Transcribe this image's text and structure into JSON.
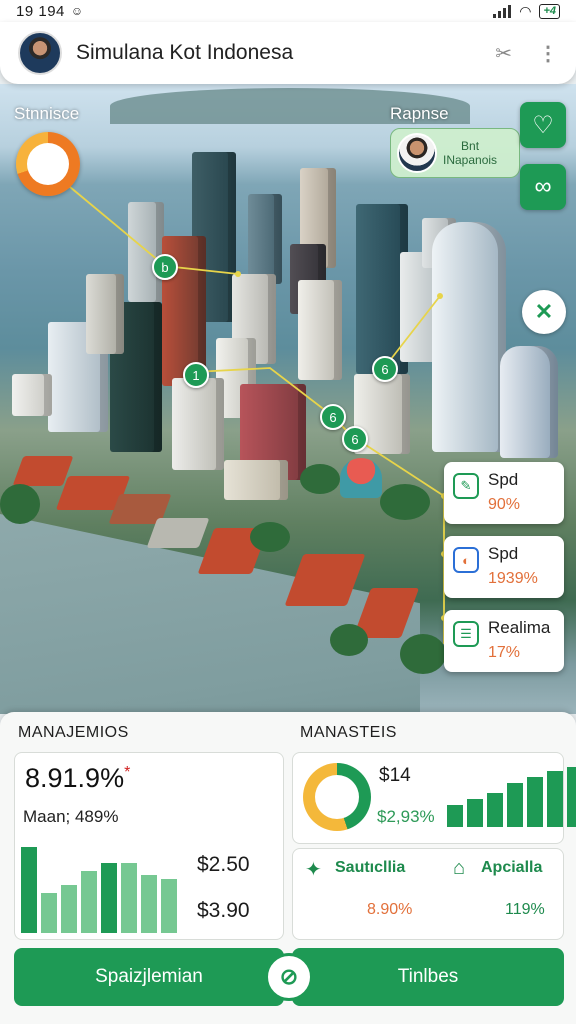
{
  "status_bar": {
    "time": "19 194",
    "battery": "+4"
  },
  "app_bar": {
    "title": "Simulana Kot Indonesa",
    "tool_icon": "tools-icon",
    "more_icon": "more-vert-icon"
  },
  "map": {
    "label_left": "Stnnisce",
    "label_right": "Rapnse",
    "profile_line1": "Bnt",
    "profile_line2": "INapanois",
    "side_icons": [
      "heart-hand-icon",
      "link-icon",
      "dna-icon"
    ],
    "pins": [
      "b",
      "1",
      "6",
      "6",
      "6"
    ],
    "info_cards": [
      {
        "label": "Spd",
        "value": "90%",
        "icon": "edit-icon"
      },
      {
        "label": "Spd",
        "value": "1939%",
        "icon": "logo-icon"
      },
      {
        "label": "Realima",
        "value": "17%",
        "icon": "list-icon"
      }
    ]
  },
  "panel": {
    "left_title": "MANAJEMIOS",
    "right_title": "MANASTEIS",
    "main_value": "8.91.9%",
    "main_sup": "*",
    "sub_value": "Maan; 489%",
    "left_chart_values": [
      86,
      40,
      48,
      62,
      70,
      70,
      58,
      54
    ],
    "money_1": "$2.50",
    "money_2": "$3.90",
    "stat_value_1": "$14",
    "stat_value_2": "$2,93%",
    "right_chart_values": [
      22,
      28,
      34,
      44,
      50,
      56,
      60
    ],
    "mini_1_label": "Sautıcllia",
    "mini_1_value": "8.90%",
    "mini_2_label": "Apcialla",
    "mini_2_value": "119%",
    "button_left": "Spaizjlemian",
    "button_right": "Tinlbes"
  },
  "colors": {
    "accent": "#1e9a55",
    "orange": "#e2703a",
    "yellow": "#f4b83a"
  }
}
